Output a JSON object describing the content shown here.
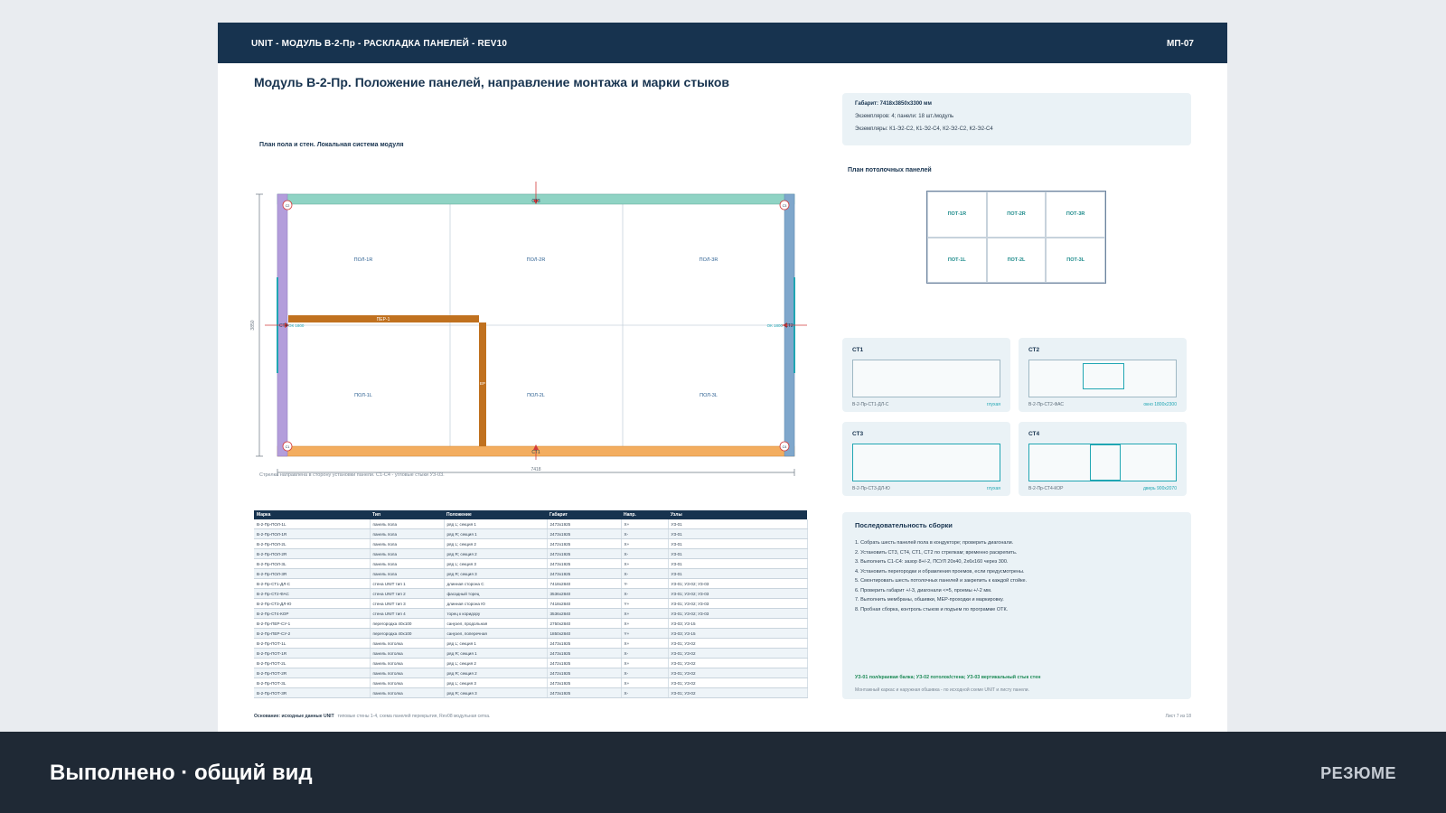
{
  "header": {
    "title": "UNIT - МОДУЛЬ В-2-Пр - РАСКЛАДКА ПАНЕЛЕЙ - REV10",
    "code": "МП-07"
  },
  "page_title": "Модуль В-2-Пр. Положение панелей, направление монтажа и марки стыков",
  "plan": {
    "caption": "План пола и стен. Локальная система модуля",
    "floor_panels": [
      "ПОЛ-1R",
      "ПОЛ-2R",
      "ПОЛ-3R",
      "ПОЛ-1L",
      "ПОЛ-2L",
      "ПОЛ-3L"
    ],
    "walls": {
      "top": "СТ3",
      "bottom": "СТ1",
      "left": "СТ4",
      "right": "СТ2"
    },
    "corners": [
      "C2",
      "C3",
      "C1",
      "C4"
    ],
    "partition_label": "ПЕР-1",
    "partition2_label": "ЕР",
    "left_marker": "ОК 1800",
    "right_marker": "ОК 1800",
    "dim_width": "7418",
    "dim_height": "3850",
    "note": "Стрелка направлена в сторону установки панели. С1-С4 - угловые стыки УЗ-03."
  },
  "info": {
    "gabarit": "Габарит: 7418x3850x3300 мм",
    "count": "Экземпляров: 4; панели: 18 шт./модуль",
    "instances": "Экземпляры: К1-Э2-С2, К1-Э2-С4, К2-Э2-С2, К2-Э2-С4"
  },
  "ceiling": {
    "caption": "План потолочных панелей",
    "panels": [
      "ПОТ-1R",
      "ПОТ-2R",
      "ПОТ-3R",
      "ПОТ-1L",
      "ПОТ-2L",
      "ПОТ-3L"
    ]
  },
  "walls": [
    {
      "title": "СТ1",
      "code": "В-2-Пр-СТ1-ДЛ-С",
      "note": "глухая"
    },
    {
      "title": "СТ2",
      "code": "В-2-Пр-СТ2-ФАС",
      "note": "окно 1800х2300"
    },
    {
      "title": "СТ3",
      "code": "В-2-Пр-СТ3-ДЛ-Ю",
      "note": "глухая"
    },
    {
      "title": "СТ4",
      "code": "В-2-Пр-СТ4-КОР",
      "note": "дверь 900х2070"
    }
  ],
  "sequence": {
    "title": "Последовательность сборки",
    "steps": [
      "1. Собрать шесть панелей пола в кондукторе; проверить диагонали.",
      "2. Установить СТ3, СТ4, СТ1, СТ2 по стрелкам; временно раскрепить.",
      "3. Выполнить С1-С4: зазор 8+/-2, ПСУЛ 20х40, 2х6х160 через 300.",
      "4. Установить перегородки и обрамления проемов, если предусмотрены.",
      "5. Смонтировать шесть потолочных панелей и закрепить к каждой стойке.",
      "6. Проверить габарит +/-3, диагонали <=5, проемы +/-2 мм.",
      "7. Выполнить мембраны, обшивки, МЕР-проходки и маркировку.",
      "8. Пробная сборка, контроль стыков и подъем по программе ОТК."
    ],
    "legend": "УЗ-01 пол/краевая балка; УЗ-02 потолок/стена; УЗ-03 вертикальный стык стен",
    "note": "Монтажный каркас и наружная обшивка - по исходной схеме UNIT и листу панели."
  },
  "table": {
    "headers": [
      "Марка",
      "Тип",
      "Положение",
      "Габарит",
      "Напр.",
      "Узлы"
    ],
    "rows": [
      [
        "В-2-Пр-ПОЛ-1L",
        "панель пола",
        "ряд L; секция 1",
        "2473х1925",
        "X+",
        "УЗ-01"
      ],
      [
        "В-2-Пр-ПОЛ-1R",
        "панель пола",
        "ряд R; секция 1",
        "2473х1925",
        "X-",
        "УЗ-01"
      ],
      [
        "В-2-Пр-ПОЛ-2L",
        "панель пола",
        "ряд L; секция 2",
        "2472х1925",
        "X+",
        "УЗ-01"
      ],
      [
        "В-2-Пр-ПОЛ-2R",
        "панель пола",
        "ряд R; секция 2",
        "2472х1925",
        "X-",
        "УЗ-01"
      ],
      [
        "В-2-Пр-ПОЛ-3L",
        "панель пола",
        "ряд L; секция 3",
        "2473х1925",
        "X+",
        "УЗ-01"
      ],
      [
        "В-2-Пр-ПОЛ-3R",
        "панель пола",
        "ряд R; секция 3",
        "2473х1925",
        "X-",
        "УЗ-01"
      ],
      [
        "В-2-Пр-СТ1-ДЛ-С",
        "стена UNIT тип 1",
        "длинная сторона С",
        "7418х2840",
        "Y-",
        "УЗ-01; УЗ-02; УЗ-03"
      ],
      [
        "В-2-Пр-СТ2-ФАС",
        "стена UNIT тип 2",
        "фасадный торец",
        "3536х2840",
        "X-",
        "УЗ-01; УЗ-02; УЗ-03"
      ],
      [
        "В-2-Пр-СТ3-ДЛ-Ю",
        "стена UNIT тип 3",
        "длинная сторона Ю",
        "7418х2840",
        "Y+",
        "УЗ-01; УЗ-02; УЗ-03"
      ],
      [
        "В-2-Пр-СТ4-КОР",
        "стена UNIT тип 4",
        "торец к коридору",
        "3536х2840",
        "X+",
        "УЗ-01; УЗ-02; УЗ-03"
      ],
      [
        "В-2-Пр-ПЕР-СУ-1",
        "перегородка 40х100",
        "санузел, продольная",
        "2750х2840",
        "X+",
        "УЗ-03; УЗ-15"
      ],
      [
        "В-2-Пр-ПЕР-СУ-2",
        "перегородка 40х100",
        "санузел, поперечная",
        "1850х2840",
        "Y+",
        "УЗ-03; УЗ-15"
      ],
      [
        "В-2-Пр-ПОТ-1L",
        "панель потолка",
        "ряд L; секция 1",
        "2473х1925",
        "X+",
        "УЗ-01; УЗ-02"
      ],
      [
        "В-2-Пр-ПОТ-1R",
        "панель потолка",
        "ряд R; секция 1",
        "2473х1925",
        "X-",
        "УЗ-01; УЗ-02"
      ],
      [
        "В-2-Пр-ПОТ-2L",
        "панель потолка",
        "ряд L; секция 2",
        "2472х1925",
        "X+",
        "УЗ-01; УЗ-02"
      ],
      [
        "В-2-Пр-ПОТ-2R",
        "панель потолка",
        "ряд R; секция 2",
        "2472х1925",
        "X-",
        "УЗ-01; УЗ-02"
      ],
      [
        "В-2-Пр-ПОТ-3L",
        "панель потолка",
        "ряд L; секция 3",
        "2473х1925",
        "X+",
        "УЗ-01; УЗ-02"
      ],
      [
        "В-2-Пр-ПОТ-3R",
        "панель потолка",
        "ряд R; секция 3",
        "2473х1925",
        "X-",
        "УЗ-01; УЗ-02"
      ]
    ]
  },
  "footer": {
    "basis_label": "Основание: исходные данные UNIT",
    "basis_rest": "типовые стены 1-4, схема панелей перекрытия, Rev08 модульная сетка.",
    "page": "Лист 7 из 18"
  },
  "bottom_bar": {
    "title": "Выполнено · общий вид",
    "right": "РЕЗЮМЕ"
  },
  "colors": {
    "header_bg": "#17334f",
    "wall_top": "#8fd3c4",
    "wall_bottom": "#f3ad5f",
    "wall_left": "#b39ddb",
    "wall_right": "#7fa7cc",
    "partition": "#c0711f",
    "accent": "#20a6b3"
  }
}
